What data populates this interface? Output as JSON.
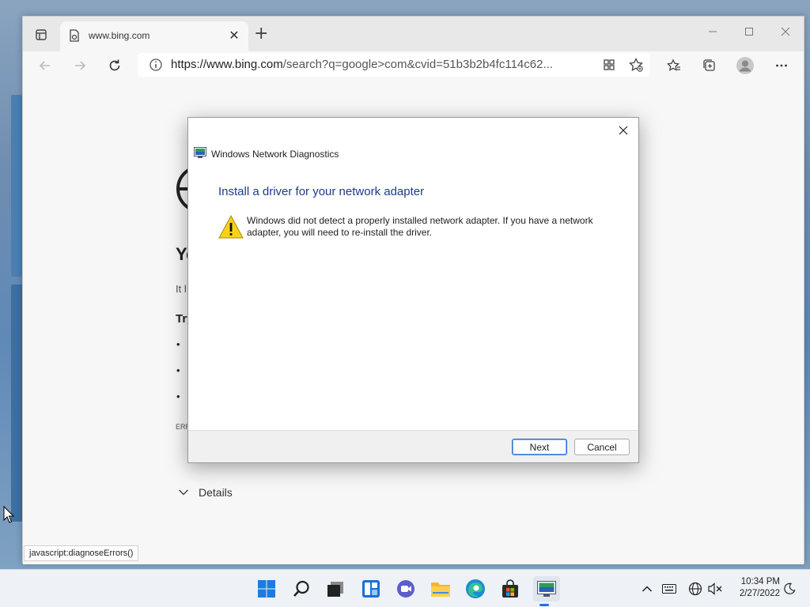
{
  "browser": {
    "tab": {
      "title": "www.bing.com"
    },
    "address": {
      "domain": "https://www.bing.com",
      "path": "/search?q=google>com&cvid=51b3b2b4fc114c62..."
    },
    "status_link": "javascript:diagnoseErrors()"
  },
  "page": {
    "heading_fragment": "Yo",
    "line_fragment": "It l",
    "subheading_fragment": "Try",
    "bullets": [
      "•",
      "•",
      "•"
    ],
    "error_fragment": "ERR",
    "details_label": "Details"
  },
  "dialog": {
    "app_title": "Windows Network Diagnostics",
    "heading": "Install a driver for your network adapter",
    "message": "Windows did not detect a properly installed network adapter. If you have a network adapter, you will need to re-install the driver.",
    "next_label": "Next",
    "cancel_label": "Cancel"
  },
  "taskbar": {
    "time": "10:34 PM",
    "date": "2/27/2022",
    "pinned": [
      "start-icon",
      "search-icon",
      "task-view-icon",
      "widgets-icon",
      "chat-icon",
      "file-explorer-icon",
      "edge-icon",
      "store-icon",
      "network-diagnostics-icon"
    ]
  },
  "colors": {
    "dialog_heading": "#1c3b8a",
    "warning_fill": "#f7d21c",
    "primary_button_border": "#2a6fc9",
    "taskbar_bg": "#eef1f5"
  }
}
